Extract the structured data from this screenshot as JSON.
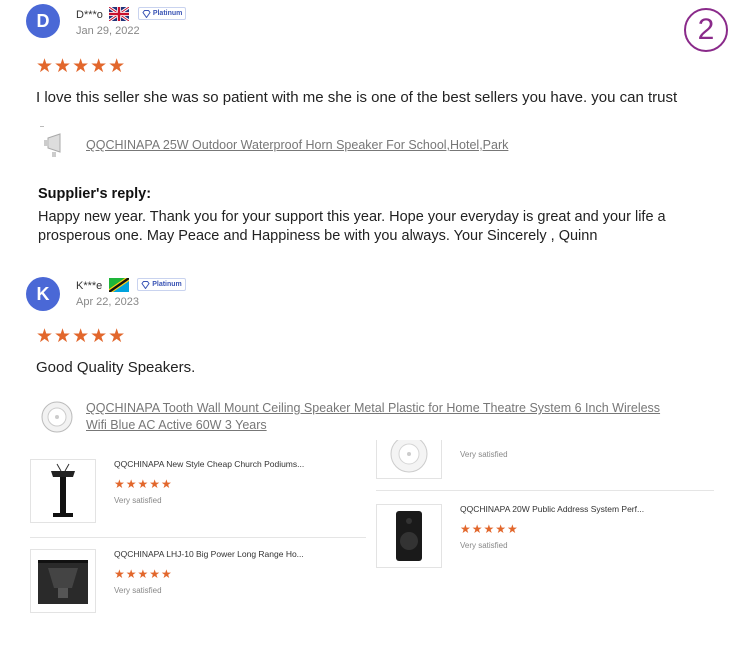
{
  "page_marker": "2",
  "reviews": [
    {
      "avatar_letter": "D",
      "username": "D***o",
      "badge": "Platinum",
      "date": "Jan 29, 2022",
      "rating": 5,
      "stars": "★★★★★",
      "text": "I love this seller she was so patient with me she is one of the best sellers you have. you can trust",
      "product": "QQCHINAPA 25W Outdoor Waterproof Horn Speaker For School,Hotel,Park",
      "reply_title": "Supplier's reply:",
      "reply_line1": "Happy new year. Thank you for your support this year. Hope your everyday is great and your life a",
      "reply_line2": "prosperous one. May Peace and Happiness be with you always. Your Sincerely , Quinn"
    },
    {
      "avatar_letter": "K",
      "username": "K***e",
      "badge": "Platinum",
      "date": "Apr 22, 2023",
      "rating": 5,
      "stars": "★★★★★",
      "text": "Good Quality Speakers.",
      "product_line1": "QQCHINAPA Tooth Wall Mount Ceiling Speaker Metal Plastic for Home Theatre System 6 Inch Wireless",
      "product_line2": "Wifi Blue AC Active 60W 3 Years"
    }
  ],
  "cards": [
    {
      "title": "QQCHINAPA New Style Cheap Church Podiums...",
      "stars": "★★★★★",
      "rating_text": "Very satisfied",
      "rating": 5
    },
    {
      "title": "QQCHINAPA LHJ-10 Big Power Long Range Ho...",
      "stars": "★★★★★",
      "rating_text": "Very satisfied",
      "rating": 5
    },
    {
      "title": "",
      "rating_text": "Very satisfied"
    },
    {
      "title": "QQCHINAPA 20W Public Address System Perf...",
      "stars": "★★★★★",
      "rating_text": "Very satisfied",
      "rating": 5
    }
  ],
  "colors": {
    "star": "#e2672c",
    "avatar": "#4a68d6",
    "marker": "#8a2a8a"
  }
}
